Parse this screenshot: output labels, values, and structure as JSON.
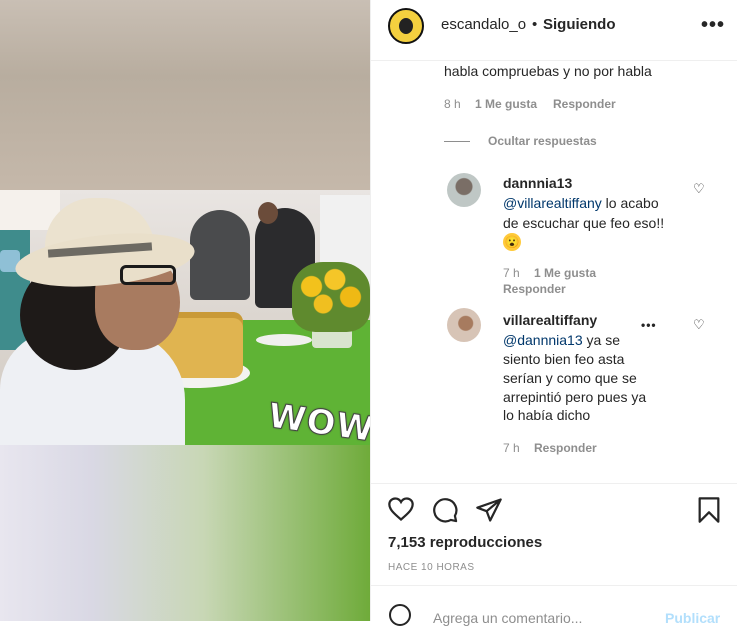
{
  "post": {
    "username": "escandalo_o",
    "separator": "•",
    "follow_state": "Siguiendo",
    "more": "•••",
    "overlay_text": "WOW"
  },
  "comments": {
    "top_text": "habla compruebas y no por habla",
    "top_time": "8 h",
    "top_likes": "1 Me gusta",
    "top_reply": "Responder",
    "hide_replies": "Ocultar respuestas",
    "replies": [
      {
        "user": "dannnia13",
        "mention": "@villarealtiffany",
        "line1_rest": " lo acabo",
        "line2": "de escuchar que feo eso!!",
        "emoji": "😮",
        "time": "7 h",
        "likes": "1 Me gusta",
        "reply": "Responder"
      },
      {
        "user": "villarealtiffany",
        "mention": "@dannnia13",
        "line1_rest": " ya se",
        "line2": "siento bien feo asta",
        "line3": "serían y como que se",
        "line4": "arrepintió pero pues ya",
        "line5": "lo había dicho",
        "time": "7 h",
        "reply": "Responder",
        "more": "•••"
      }
    ]
  },
  "actions": {
    "views": "7,153 reproducciones",
    "time_ago": "HACE 10 HORAS",
    "icons": [
      "heart-icon",
      "comment-icon",
      "share-icon",
      "bookmark-icon"
    ]
  },
  "add_comment": {
    "placeholder": "Agrega un comentario...",
    "publish": "Publicar"
  }
}
